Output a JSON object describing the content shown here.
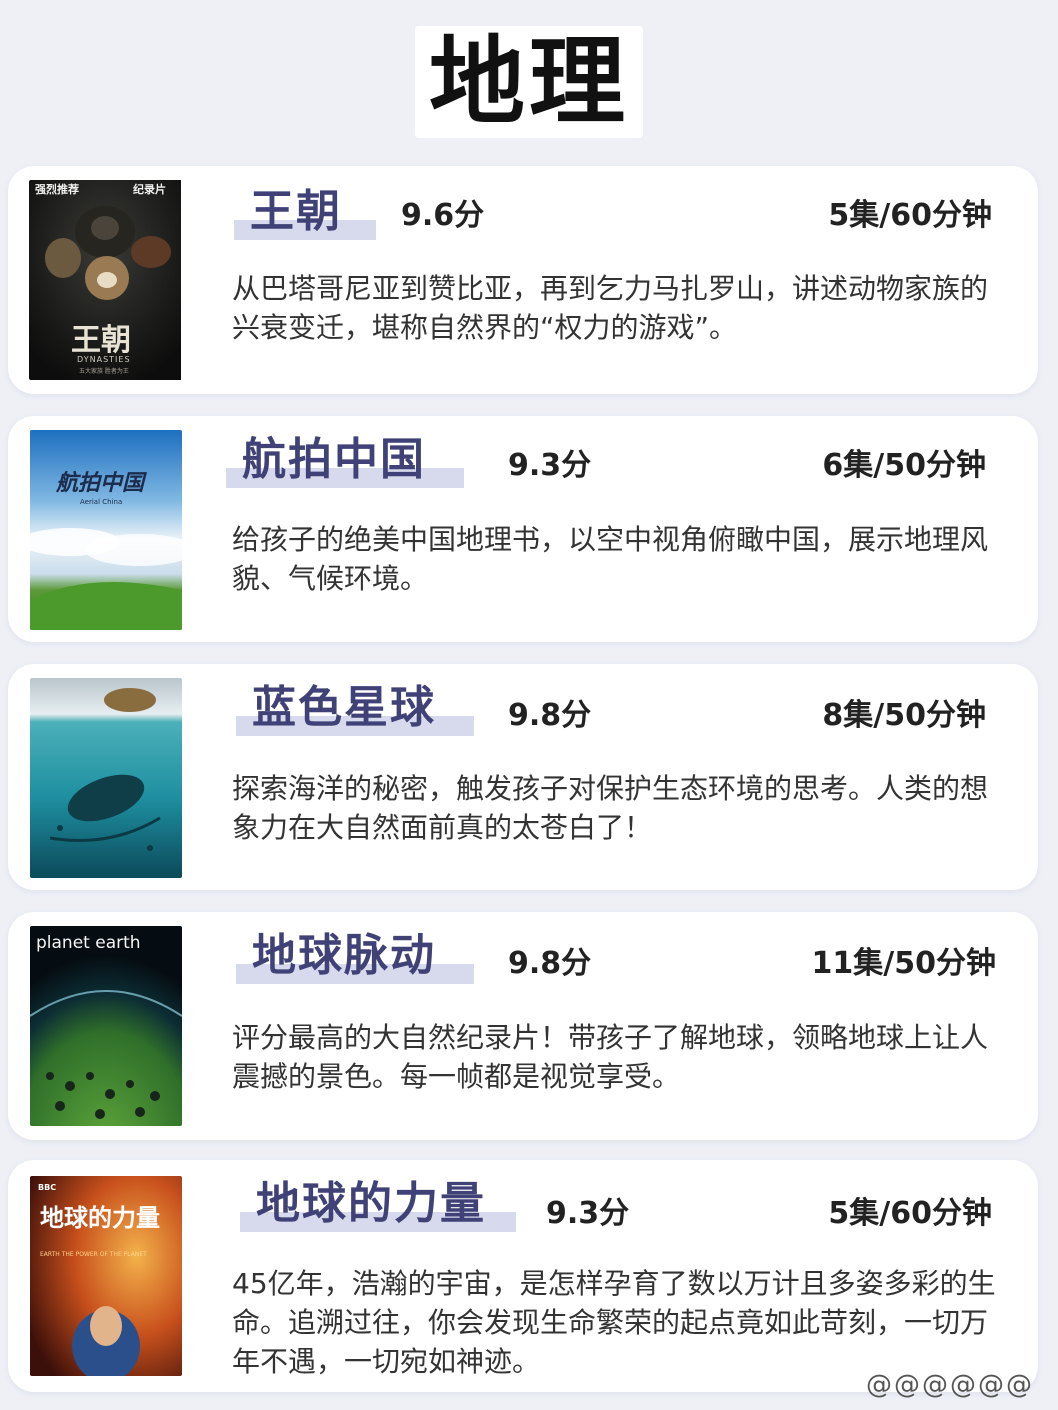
{
  "title": "地理",
  "items": [
    {
      "name": "王朝",
      "score": "9.6分",
      "episodes": "5集/60分钟",
      "description": "从巴塔哥尼亚到赞比亚，再到乞力马扎罗山，讲述动物家族的兴衰变迁，堪称自然界的“权力的游戏”。",
      "poster": {
        "top_text": "强烈推荐",
        "top_text_right": "纪录片",
        "title_text": "王朝",
        "sub_text": "DYNASTIES",
        "bottom_text": "五大家族 胜者为王"
      }
    },
    {
      "name": "航拍中国",
      "score": "9.3分",
      "episodes": "6集/50分钟",
      "description": "给孩子的绝美中国地理书，以空中视角俯瞰中国，展示地理风貌、气候环境。",
      "poster": {
        "title_text": "航拍中国",
        "sub_text": "Aerial China"
      }
    },
    {
      "name": "蓝色星球",
      "score": "9.8分",
      "episodes": "8集/50分钟",
      "description": "探索海洋的秘密，触发孩子对保护生态环境的思考。人类的想象力在大自然面前真的太苍白了！",
      "poster": {}
    },
    {
      "name": "地球脉动",
      "score": "9.8分",
      "episodes": "11集/50分钟",
      "description": "评分最高的大自然纪录片！带孩子了解地球，领略地球上让人震撼的景色。每一帧都是视觉享受。",
      "poster": {
        "title_text": "planet earth"
      }
    },
    {
      "name": "地球的力量",
      "score": "9.3分",
      "episodes": "5集/60分钟",
      "description": "45亿年，浩瀚的宇宙，是怎样孕育了数以万计且多姿多彩的生命。追溯过往，你会发现生命繁荣的起点竟如此苛刻，一切万年不遇，一切宛如神迹。",
      "poster": {
        "brand": "BBC",
        "title_text": "地球的力量",
        "sub_text": "EARTH THE POWER OF THE PLANET"
      }
    }
  ],
  "watermark": "@@@@@@"
}
